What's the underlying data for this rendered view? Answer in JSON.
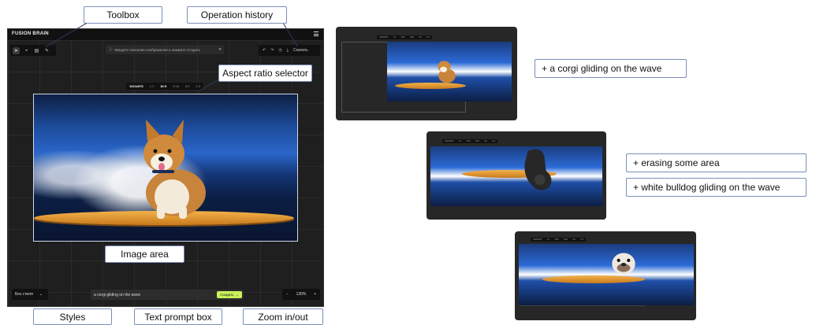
{
  "annotations": {
    "toolbox": "Toolbox",
    "operation_history": "Operation history",
    "aspect_ratio_selector": "Aspect ratio selector",
    "image_area": "Image area",
    "styles": "Styles",
    "text_prompt_box": "Text prompt box",
    "zoom": "Zoom in/out",
    "step1": "+ a corgi gliding on the wave",
    "step2a": "+ erasing some area",
    "step2b": "+ white bulldog gliding on the wave"
  },
  "app": {
    "brand": "FUSION BRAIN",
    "hint": "Введите описание изображения и нажмите Создать",
    "history_download": "Скачать",
    "aspect_options": [
      "1024x576",
      "1:1",
      "16:9",
      "9:16",
      "3:2",
      "2:3"
    ],
    "aspect_selected": "16:9",
    "styles_label": "Без стиля",
    "prompt_value": "a corgi gliding on the wave",
    "create_label": "Создать",
    "zoom_value": "130%",
    "zoom_minus": "−",
    "zoom_plus": "+"
  },
  "colors": {
    "accent": "#c9f25a",
    "annotation_border": "#7b8fb8",
    "app_bg": "#1f1f1f"
  }
}
